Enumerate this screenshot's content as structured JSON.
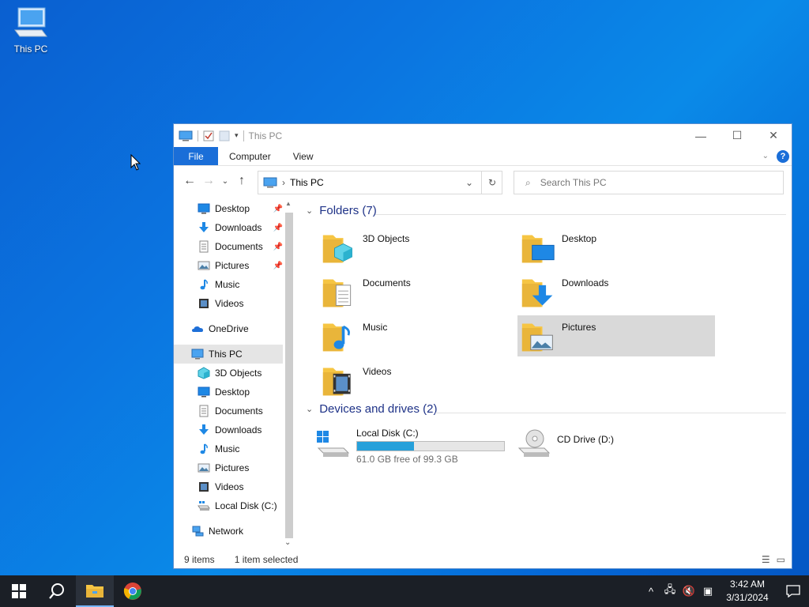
{
  "desktop": {
    "icon_label": "This PC"
  },
  "window": {
    "title": "This PC",
    "ribbon_tabs": [
      "File",
      "Computer",
      "View"
    ],
    "address": "This PC",
    "search_placeholder": "Search This PC"
  },
  "nav": {
    "quick": [
      {
        "label": "Desktop",
        "icon": "desktop-icon",
        "pinned": true
      },
      {
        "label": "Downloads",
        "icon": "downloads-icon",
        "pinned": true
      },
      {
        "label": "Documents",
        "icon": "documents-icon",
        "pinned": true
      },
      {
        "label": "Pictures",
        "icon": "pictures-icon",
        "pinned": true
      },
      {
        "label": "Music",
        "icon": "music-icon",
        "pinned": false
      },
      {
        "label": "Videos",
        "icon": "videos-icon",
        "pinned": false
      }
    ],
    "onedrive": "OneDrive",
    "this_pc": "This PC",
    "pc_items": [
      {
        "label": "3D Objects",
        "icon": "3d-objects-icon"
      },
      {
        "label": "Desktop",
        "icon": "desktop-icon"
      },
      {
        "label": "Documents",
        "icon": "documents-icon"
      },
      {
        "label": "Downloads",
        "icon": "downloads-icon"
      },
      {
        "label": "Music",
        "icon": "music-icon"
      },
      {
        "label": "Pictures",
        "icon": "pictures-icon"
      },
      {
        "label": "Videos",
        "icon": "videos-icon"
      },
      {
        "label": "Local Disk (C:)",
        "icon": "disk-icon"
      }
    ],
    "network": "Network"
  },
  "content": {
    "folders_header": "Folders (7)",
    "folders": [
      {
        "label": "3D Objects",
        "icon": "3d-objects-icon"
      },
      {
        "label": "Desktop",
        "icon": "desktop-icon"
      },
      {
        "label": "Documents",
        "icon": "documents-icon"
      },
      {
        "label": "Downloads",
        "icon": "downloads-icon"
      },
      {
        "label": "Music",
        "icon": "music-icon"
      },
      {
        "label": "Pictures",
        "icon": "pictures-icon"
      },
      {
        "label": "Videos",
        "icon": "videos-icon"
      }
    ],
    "selected_folder": "Pictures",
    "drives_header": "Devices and drives (2)",
    "drives": [
      {
        "label": "Local Disk (C:)",
        "free_text": "61.0 GB free of 99.3 GB",
        "used_fraction": 0.386
      },
      {
        "label": "CD Drive (D:)"
      }
    ]
  },
  "status": {
    "items": "9 items",
    "selected": "1 item selected"
  },
  "taskbar": {
    "time": "3:42 AM",
    "date": "3/31/2024"
  },
  "colors": {
    "accent": "#1a6ed8",
    "section": "#1e3287",
    "bar_fill": "#26a0da"
  }
}
